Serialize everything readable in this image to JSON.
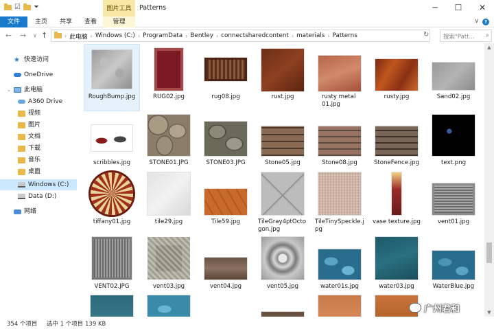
{
  "window": {
    "title": "Patterns",
    "context_tab": "图片工具",
    "minimize": "─",
    "maximize": "☐",
    "close": "✕"
  },
  "ribbon": {
    "tabs": [
      "文件",
      "主页",
      "共享",
      "查看",
      "管理"
    ],
    "collapse_glyph": "∨",
    "help_glyph": "?"
  },
  "address": {
    "path": [
      "此电脑",
      "Windows (C:)",
      "ProgramData",
      "Bentley",
      "connectsharedcontent",
      "materials",
      "Patterns"
    ],
    "search_placeholder": "搜索\"Patt..."
  },
  "nav_pane": {
    "items": [
      {
        "label": "快速访问",
        "icon": "star-icon"
      },
      {
        "label": "OneDrive",
        "icon": "cloud-icon"
      },
      {
        "label": "此电脑",
        "icon": "computer-icon"
      },
      {
        "label": "A360 Drive",
        "icon": "cloud-drive-icon"
      },
      {
        "label": "视频",
        "icon": "folder-icon"
      },
      {
        "label": "图片",
        "icon": "folder-icon"
      },
      {
        "label": "文档",
        "icon": "folder-icon"
      },
      {
        "label": "下载",
        "icon": "folder-icon"
      },
      {
        "label": "音乐",
        "icon": "folder-icon"
      },
      {
        "label": "桌面",
        "icon": "folder-icon"
      },
      {
        "label": "Windows (C:)",
        "icon": "drive-icon"
      },
      {
        "label": "Data (D:)",
        "icon": "drive-icon"
      },
      {
        "label": "网络",
        "icon": "network-icon"
      }
    ]
  },
  "files": [
    {
      "name": "RoughBump.jpg",
      "selected": true
    },
    {
      "name": "RUG02.jpg"
    },
    {
      "name": "rug08.jpg"
    },
    {
      "name": "rust.jpg"
    },
    {
      "name": "rusty metal01.jpg"
    },
    {
      "name": "rusty.jpg"
    },
    {
      "name": "Sand02.jpg"
    },
    {
      "name": "scribbles.jpg"
    },
    {
      "name": "STONE01.JPG"
    },
    {
      "name": "STONE03.JPG"
    },
    {
      "name": "Stone05.jpg"
    },
    {
      "name": "Stone08.jpg"
    },
    {
      "name": "StoneFence.jpg"
    },
    {
      "name": "text.png"
    },
    {
      "name": "tiffany01.jpg"
    },
    {
      "name": "tile29.jpg"
    },
    {
      "name": "Tile59.jpg"
    },
    {
      "name": "TileGray4ptOctogon.jpg"
    },
    {
      "name": "TileTinySpeckle.jpg"
    },
    {
      "name": "vase texture.jpg"
    },
    {
      "name": "vent01.jpg"
    },
    {
      "name": "VENT02.JPG"
    },
    {
      "name": "vent03.jpg"
    },
    {
      "name": "vent04.jpg"
    },
    {
      "name": "vent05.jpg"
    },
    {
      "name": "water01s.jpg"
    },
    {
      "name": "water03.jpg"
    },
    {
      "name": "WaterBlue.jpg"
    }
  ],
  "status": {
    "count": "354 个项目",
    "selection": "选中 1 个项目  139 KB"
  },
  "watermark": {
    "text": "广州君和"
  },
  "colors": {
    "accent": "#1979ca",
    "context_tab": "#f8e7a7",
    "selection": "#cce8ff"
  }
}
